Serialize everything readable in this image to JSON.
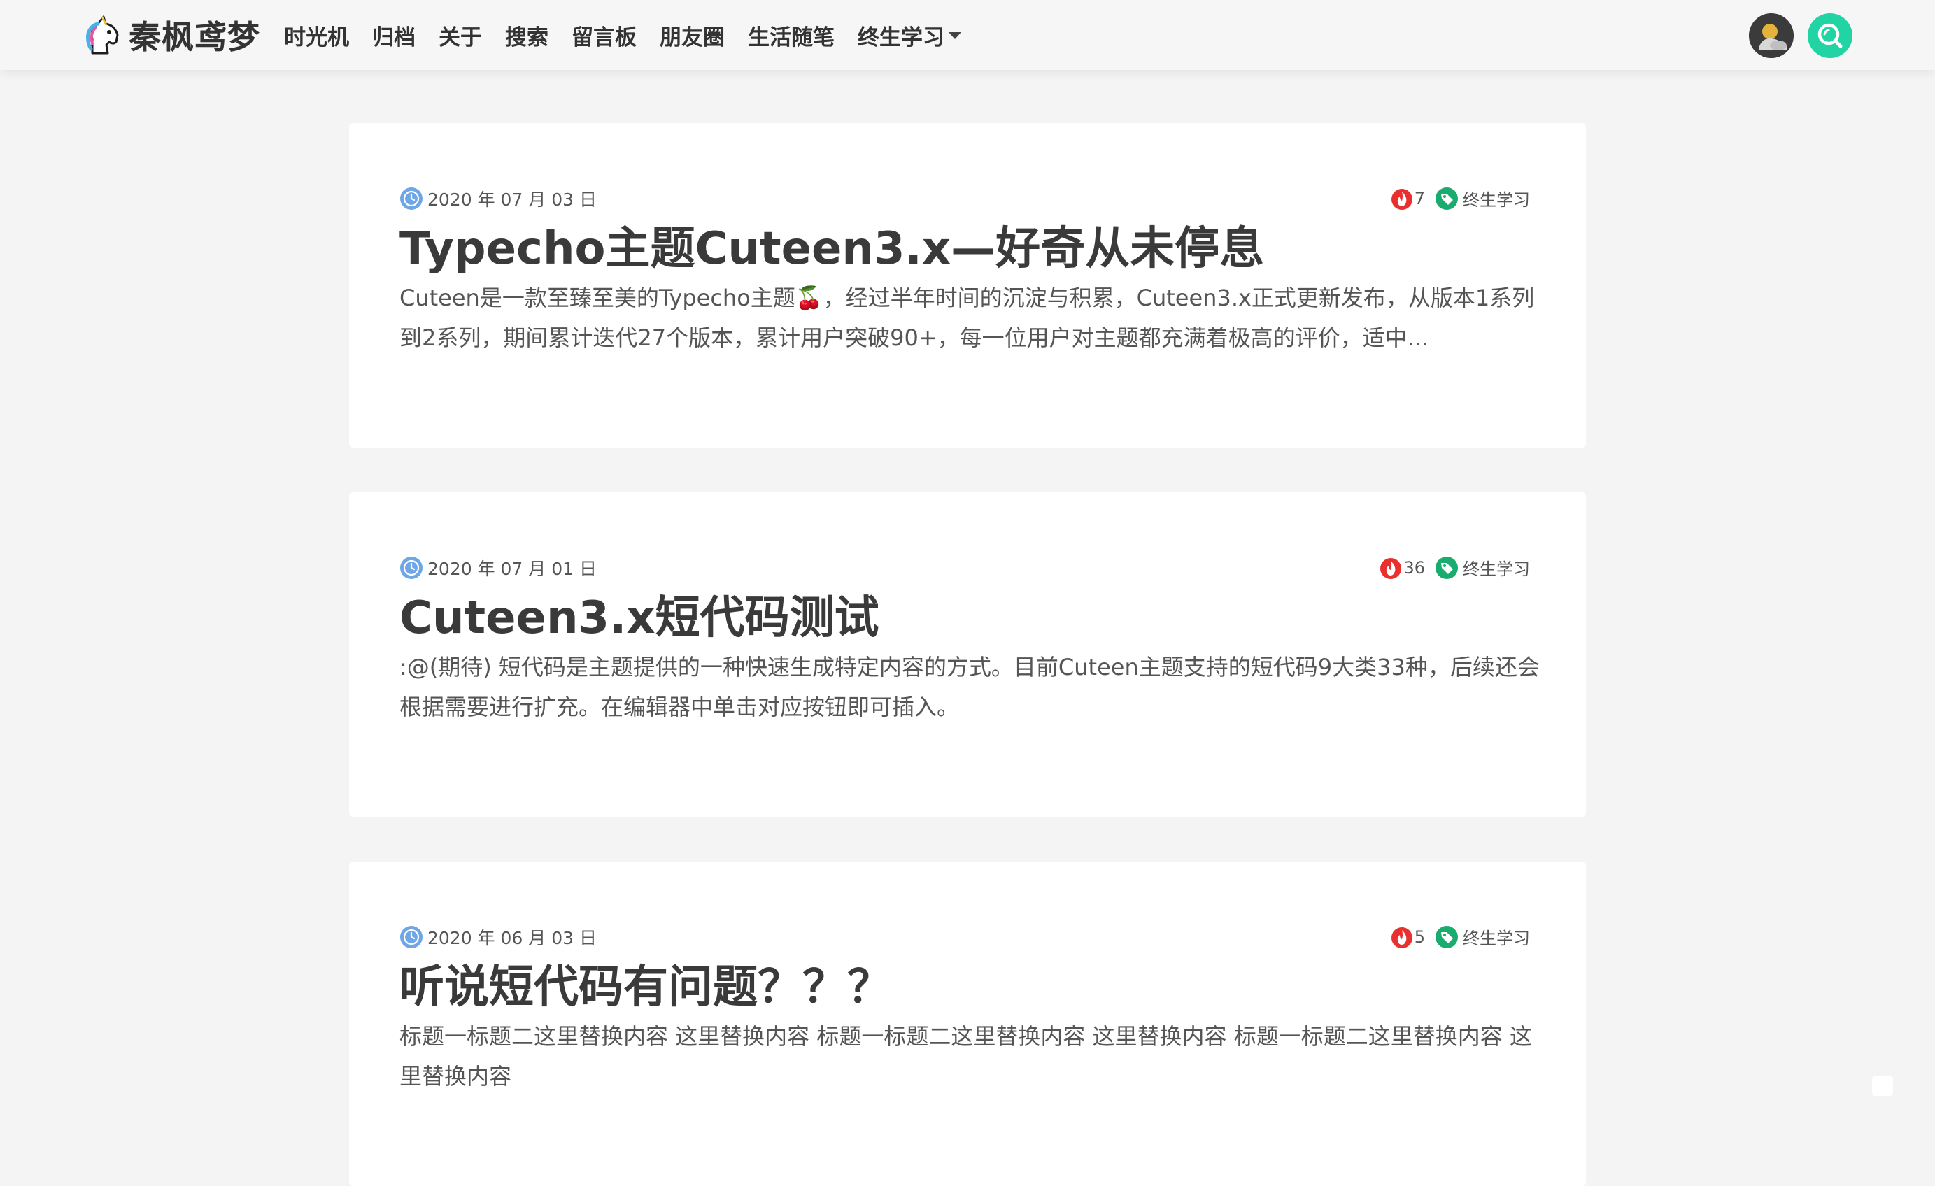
{
  "site": {
    "name": "秦枫鸢梦",
    "logo_icon": "unicorn-icon"
  },
  "nav": {
    "items": [
      "时光机",
      "归档",
      "关于",
      "搜索",
      "留言板",
      "朋友圈",
      "生活随笔"
    ],
    "dropdown_label": "终生学习"
  },
  "header_actions": {
    "avatar_icon": "user-avatar-icon",
    "search_icon": "search-icon",
    "search_color": "#22d3a3"
  },
  "posts": [
    {
      "date": "2020 年 07 月 03 日",
      "views": "7",
      "tag": "终生学习",
      "title": "Typecho主题Cuteen3.x—好奇从未停息",
      "excerpt": "Cuteen是一款至臻至美的Typecho主题🍒，经过半年时间的沉淀与积累，Cuteen3.x正式更新发布，从版本1系列到2系列，期间累计迭代27个版本，累计用户突破90+，每一位用户对主题都充满着极高的评价，适中..."
    },
    {
      "date": "2020 年 07 月 01 日",
      "views": "36",
      "tag": "终生学习",
      "title": "Cuteen3.x短代码测试",
      "excerpt": ":@(期待) 短代码是主题提供的一种快速生成特定内容的方式。目前Cuteen主题支持的短代码9大类33种，后续还会根据需要进行扩充。在编辑器中单击对应按钮即可插入。"
    },
    {
      "date": "2020 年 06 月 03 日",
      "views": "5",
      "tag": "终生学习",
      "title": "听说短代码有问题？？？",
      "excerpt": "标题一标题二这里替换内容 这里替换内容 标题一标题二这里替换内容 这里替换内容 标题一标题二这里替换内容 这里替换内容"
    }
  ],
  "colors": {
    "accent": "#22d3a3",
    "fire": "#e8312f",
    "tag": "#1aab6f",
    "clock": "#6ea6e6"
  }
}
